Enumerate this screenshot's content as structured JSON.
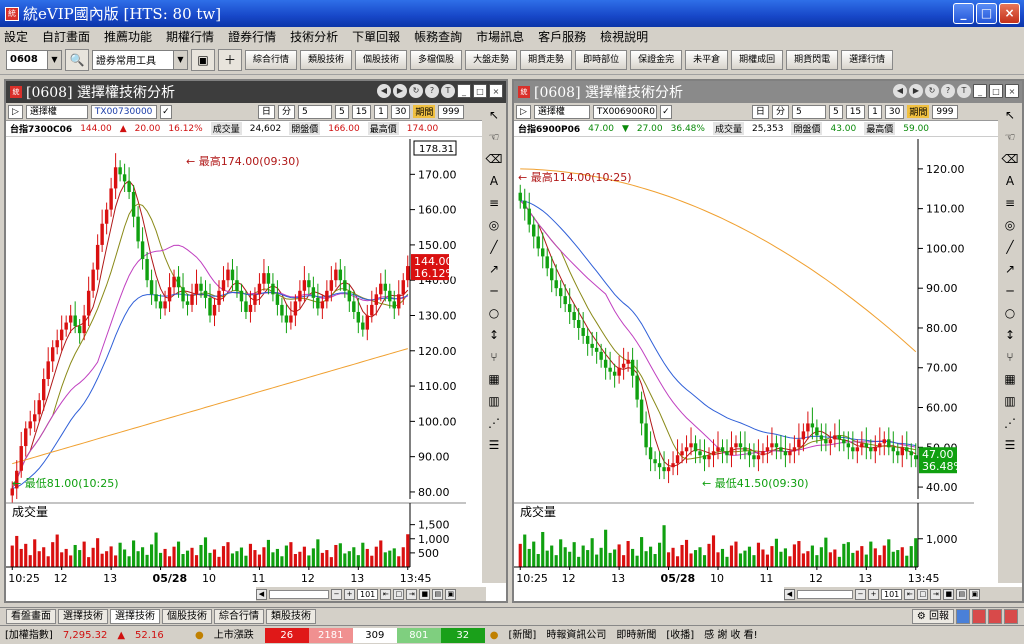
{
  "window": {
    "title": "統eVIP國內版  [HTS: 80 tw]",
    "app_icon": "統",
    "minimize": "_",
    "maximize": "□",
    "close": "×"
  },
  "menu": [
    "設定",
    "自訂畫面",
    "推薦功能",
    "期權行情",
    "證券行情",
    "技術分析",
    "下單回報",
    "帳務查詢",
    "市場訊息",
    "客戶服務",
    "檢視說明"
  ],
  "toolbar": {
    "code_value": "0608",
    "tool_select": "證券常用工具",
    "buttons": [
      "綜合行情",
      "類股技術",
      "個股技術",
      "多檔個股",
      "大盤走勢",
      "期貨走勢",
      "即時部位",
      "保證金完",
      "未平倉",
      "期權成回",
      "期貨閃電",
      "選擇行情"
    ]
  },
  "colors": {
    "up": "#d91010",
    "down": "#10a010",
    "ma5": "#b01818",
    "ma10": "#8a8a18",
    "ma20": "#c040c0",
    "ma60": "#3060d8",
    "ma120": "#f0a030"
  },
  "left_panel": {
    "title": "[0608] 選擇權技術分析",
    "product_select": "選擇權",
    "contract_select": "TX00730000",
    "period_label": "日",
    "minute_label": "分",
    "minute_value": "5",
    "quick_periods": [
      "5",
      "15",
      "1",
      "30"
    ],
    "bars_label": "期間",
    "bars_value": "999",
    "quote": {
      "name": "台指7300C06",
      "price": "144.00",
      "change_arrow": "▲",
      "change": "20.00",
      "pct": "16.12%",
      "vol_label": "成交量",
      "vol": "24,602",
      "open_label": "開盤價",
      "open": "166.00",
      "high_label": "最高價",
      "high": "174.00"
    },
    "price_box": "178.31",
    "tag_price": "144.00",
    "tag_pct": "16.12%",
    "high_note": "← 最高174.00(09:30)",
    "low_note": "← 最低81.00(10:25)",
    "volume_label": "成交量",
    "scroll_value": "101"
  },
  "right_panel": {
    "title": "[0608] 選擇權技術分析",
    "product_select": "選擇權",
    "contract_select": "TX006900R0",
    "period_label": "日",
    "minute_label": "分",
    "minute_value": "5",
    "quick_periods": [
      "5",
      "15",
      "1",
      "30"
    ],
    "bars_label": "期間",
    "bars_value": "999",
    "quote": {
      "name": "台指6900P06",
      "price": "47.00",
      "change_arrow": "▼",
      "change": "27.00",
      "pct": "36.48%",
      "vol_label": "成交量",
      "vol": "25,353",
      "open_label": "開盤價",
      "open": "43.00",
      "high_label": "最高價",
      "high": "59.00"
    },
    "tag_price": "47.00",
    "tag_pct": "36.48%",
    "high_note": "← 最高114.00(10:25)",
    "low_note": "← 最低41.50(09:30)",
    "volume_label": "成交量",
    "scroll_value": "101",
    "sketch_btn": "回報"
  },
  "chart_data": [
    {
      "type": "candlestick",
      "title": "台指7300C06",
      "ylim": [
        78,
        178.31
      ],
      "yticks": [
        "170.00",
        "160.00",
        "150.00",
        "140.00",
        "130.00",
        "120.00",
        "110.00",
        "100.00",
        "90.00",
        "80.00"
      ],
      "ytick_values": [
        170,
        160,
        150,
        140,
        130,
        120,
        110,
        100,
        90,
        80
      ],
      "xticks": [
        "10:25",
        "12",
        "13",
        "05/28",
        "10",
        "11",
        "12",
        "13",
        "13:45"
      ],
      "xtick_index": [
        0,
        11,
        22,
        33,
        44,
        55,
        66,
        77,
        88
      ],
      "close": [
        81,
        86,
        93,
        98,
        100,
        102,
        106,
        112,
        117,
        121,
        123,
        126,
        128,
        130,
        127,
        125,
        130,
        137,
        143,
        150,
        156,
        160,
        166,
        172,
        170,
        168,
        165,
        158,
        151,
        146,
        140,
        136,
        134,
        132,
        134,
        138,
        141,
        138,
        134,
        133,
        136,
        139,
        137,
        135,
        130,
        133,
        137,
        140,
        143,
        140,
        137,
        134,
        131,
        133,
        136,
        139,
        142,
        139,
        136,
        133,
        130,
        128,
        130,
        134,
        137,
        140,
        138,
        135,
        132,
        134,
        137,
        140,
        143,
        140,
        137,
        134,
        131,
        128,
        126,
        130,
        133,
        136,
        139,
        137,
        134,
        132,
        136,
        140,
        144
      ],
      "vol_ticks": [
        "1,500",
        "1,000",
        "500"
      ],
      "vol_tick_values": [
        1500,
        1000,
        500
      ],
      "vol_max": 1700,
      "volume": [
        760,
        1100,
        640,
        820,
        420,
        980,
        560,
        700,
        380,
        880,
        1150,
        520,
        640,
        410,
        780,
        600,
        900,
        350,
        680,
        1020,
        470,
        560,
        730,
        410,
        860,
        620,
        380,
        940,
        560,
        700,
        430,
        800,
        1220,
        500,
        640,
        380,
        720,
        900,
        460,
        580,
        680,
        420,
        780,
        1050,
        500,
        620,
        360,
        740,
        880,
        480,
        560,
        690,
        400,
        820,
        600,
        440,
        700,
        960,
        520,
        640,
        380,
        760,
        880,
        460,
        540,
        720,
        410,
        660,
        980,
        500,
        600,
        350,
        780,
        840,
        480,
        560,
        700,
        420,
        860,
        640,
        400,
        720,
        940,
        520,
        580,
        660,
        380,
        700,
        1160
      ]
    },
    {
      "type": "candlestick",
      "title": "台指6900P06",
      "ylim": [
        37,
        126
      ],
      "yticks": [
        "120.00",
        "110.00",
        "100.00",
        "90.00",
        "80.00",
        "70.00",
        "60.00",
        "50.00",
        "40.00"
      ],
      "ytick_values": [
        120,
        110,
        100,
        90,
        80,
        70,
        60,
        50,
        40
      ],
      "xticks": [
        "10:25",
        "12",
        "13",
        "05/28",
        "10",
        "11",
        "12",
        "13",
        "13:45"
      ],
      "xtick_index": [
        0,
        11,
        22,
        33,
        44,
        55,
        66,
        77,
        88
      ],
      "close": [
        112,
        110,
        106,
        103,
        100,
        98,
        95,
        92,
        90,
        88,
        86,
        84,
        82,
        80,
        78,
        76,
        75,
        74,
        72,
        70,
        69,
        68,
        70,
        71,
        72,
        68,
        62,
        56,
        50,
        47,
        46,
        45,
        44,
        45,
        46,
        48,
        49,
        50,
        51,
        49,
        48,
        47,
        48,
        49,
        50,
        49,
        48,
        50,
        51,
        50,
        49,
        48,
        47,
        48,
        49,
        50,
        51,
        50,
        49,
        48,
        49,
        50,
        52,
        54,
        56,
        55,
        53,
        52,
        51,
        52,
        53,
        52,
        51,
        50,
        49,
        50,
        51,
        50,
        49,
        50,
        51,
        52,
        50,
        49,
        48,
        50,
        49,
        48,
        47
      ],
      "vol_ticks": [
        "1,000"
      ],
      "vol_tick_values": [
        1000
      ],
      "vol_max": 1700,
      "volume": [
        820,
        1150,
        640,
        900,
        460,
        1240,
        580,
        760,
        420,
        980,
        700,
        540,
        880,
        360,
        760,
        600,
        1020,
        440,
        680,
        1320,
        500,
        620,
        800,
        420,
        920,
        640,
        400,
        1060,
        560,
        720,
        460,
        860,
        1480,
        520,
        680,
        380,
        780,
        960,
        480,
        600,
        700,
        420,
        820,
        1120,
        520,
        640,
        360,
        760,
        900,
        480,
        580,
        720,
        420,
        860,
        620,
        440,
        740,
        1000,
        540,
        660,
        380,
        800,
        920,
        480,
        560,
        760,
        420,
        700,
        1040,
        520,
        620,
        360,
        820,
        880,
        500,
        580,
        740,
        440,
        900,
        660,
        420,
        760,
        980,
        540,
        600,
        700,
        400,
        740,
        1020
      ]
    }
  ],
  "tabs": [
    "看盤畫面",
    "選擇技術",
    "選擇技術",
    "個股技術",
    "綜合行情",
    "類股技術"
  ],
  "active_tab": 2,
  "status": {
    "index_label": "[加權指數]",
    "index_value": "7,295.32",
    "index_arrow": "▲",
    "index_change": "52.16",
    "breadth_label": "上市漲跌",
    "limit_up": "26",
    "up": "2181",
    "flat": "309",
    "down": "801",
    "limit_down": "32",
    "news_label": "[新聞]",
    "news_source": "時報資訊公司",
    "news_type": "即時新聞",
    "news_tag": "[收播]",
    "news_text": "感  謝  收  看!"
  }
}
